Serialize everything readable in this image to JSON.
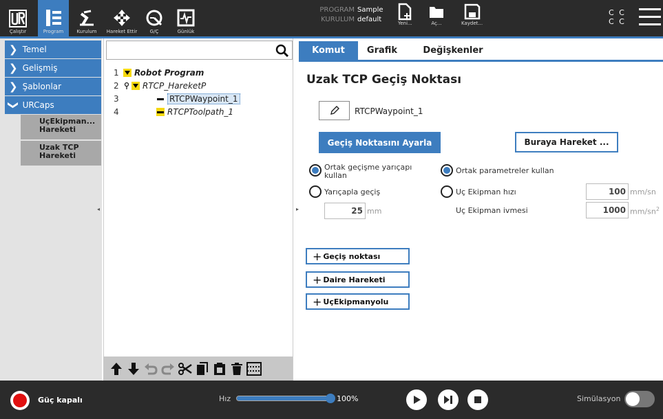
{
  "topnav": {
    "items": [
      {
        "label": "Çalıştır",
        "icon": "ur-logo-icon"
      },
      {
        "label": "Program",
        "icon": "program-icon"
      },
      {
        "label": "Kurulum",
        "icon": "robot-arm-icon"
      },
      {
        "label": "Hareket Ettir",
        "icon": "move-arrows-icon"
      },
      {
        "label": "G/Ç",
        "icon": "io-icon"
      },
      {
        "label": "Günlük",
        "icon": "log-icon"
      }
    ],
    "program_key": "PROGRAM",
    "program_value": "Sample",
    "installation_key": "KURULUM",
    "installation_value": "default",
    "new_label": "Yeni...",
    "open_label": "Aç...",
    "save_label": "Kaydet...",
    "cc_line1": "C C",
    "cc_line2": "C C"
  },
  "sidebar": {
    "items": [
      {
        "label": "Temel"
      },
      {
        "label": "Gelişmiş"
      },
      {
        "label": "Şablonlar"
      },
      {
        "label": "URCaps"
      }
    ],
    "subitems": [
      {
        "line1": "UçEkipman...",
        "line2": "Hareketi"
      },
      {
        "line1": "Uzak TCP",
        "line2": "Hareketi"
      }
    ]
  },
  "tree": {
    "search_value": "",
    "rows": [
      {
        "num": "1",
        "label": "Robot Program"
      },
      {
        "num": "2",
        "label": "RTCP_HareketP"
      },
      {
        "num": "3",
        "label": "RTCPWaypoint_1"
      },
      {
        "num": "4",
        "label": "RTCPToolpath_1"
      }
    ]
  },
  "main": {
    "tabs": [
      "Komut",
      "Grafik",
      "Değişkenler"
    ],
    "title": "Uzak TCP Geçiş Noktası",
    "waypoint_name": "RTCPWaypoint_1",
    "set_waypoint_label": "Geçiş Noktasını Ayarla",
    "move_here_label": "Buraya Hareket ...",
    "blend_shared_line1": "Ortak geçişme yarıçapı",
    "blend_shared_line2": "kullan",
    "blend_radius_label": "Yarıçapla geçiş",
    "blend_radius_value": "25",
    "blend_radius_unit": "mm",
    "shared_params_label": "Ortak parametreler kullan",
    "tool_speed_label": "Uç Ekipman hızı",
    "tool_speed_value": "100",
    "tool_speed_unit": "mm/sn",
    "tool_accel_label": "Uç Ekipman ivmesi",
    "tool_accel_value": "1000",
    "tool_accel_unit": "mm/sn",
    "tool_accel_unit_sup": "2",
    "add_buttons": [
      "Geçiş noktası",
      "Daire Hareketi",
      "UçEkipmanyolu"
    ],
    "selected_radio_left": "shared_blend",
    "selected_radio_right": "shared_params"
  },
  "bottombar": {
    "power_label": "Güç kapalı",
    "speed_label": "Hız",
    "speed_value": "100%",
    "speed_fraction": 1.0,
    "simulation_label": "Simülasyon",
    "simulation_on": false
  },
  "colors": {
    "accent": "#3d7dbf",
    "dark_bar": "#2b2b2b",
    "program_node": "#f6d90e",
    "power_off": "#e01010"
  }
}
